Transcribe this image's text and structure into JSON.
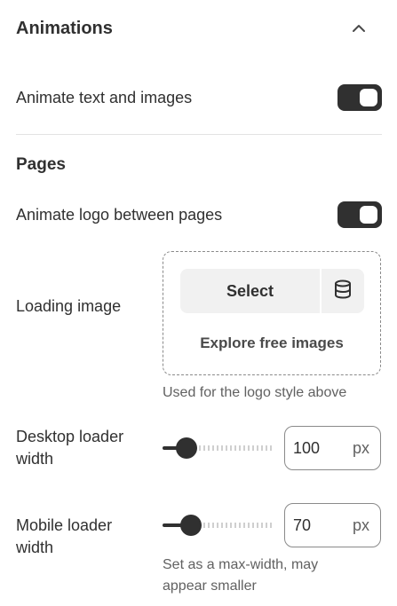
{
  "section": {
    "title": "Animations"
  },
  "animate_text": {
    "label": "Animate text and images",
    "enabled": true
  },
  "pages": {
    "heading": "Pages",
    "animate_logo": {
      "label": "Animate logo between pages",
      "enabled": true
    }
  },
  "loading_image": {
    "label": "Loading image",
    "select_label": "Select",
    "explore_label": "Explore free images",
    "help": "Used for the logo style above"
  },
  "desktop_loader": {
    "label_line1": "Desktop loader",
    "label_line2": "width",
    "value": "100",
    "unit": "px",
    "slider_fraction": 0.15
  },
  "mobile_loader": {
    "label_line1": "Mobile loader",
    "label_line2": "width",
    "value": "70",
    "unit": "px",
    "slider_fraction": 0.2,
    "help_line1": "Set as a max-width, may",
    "help_line2": "appear smaller"
  },
  "icons": {
    "collapse": "chevron-up-icon",
    "library": "database-icon"
  },
  "colors": {
    "accent": "#303030",
    "border": "#8a8a8a",
    "muted": "#616161"
  }
}
